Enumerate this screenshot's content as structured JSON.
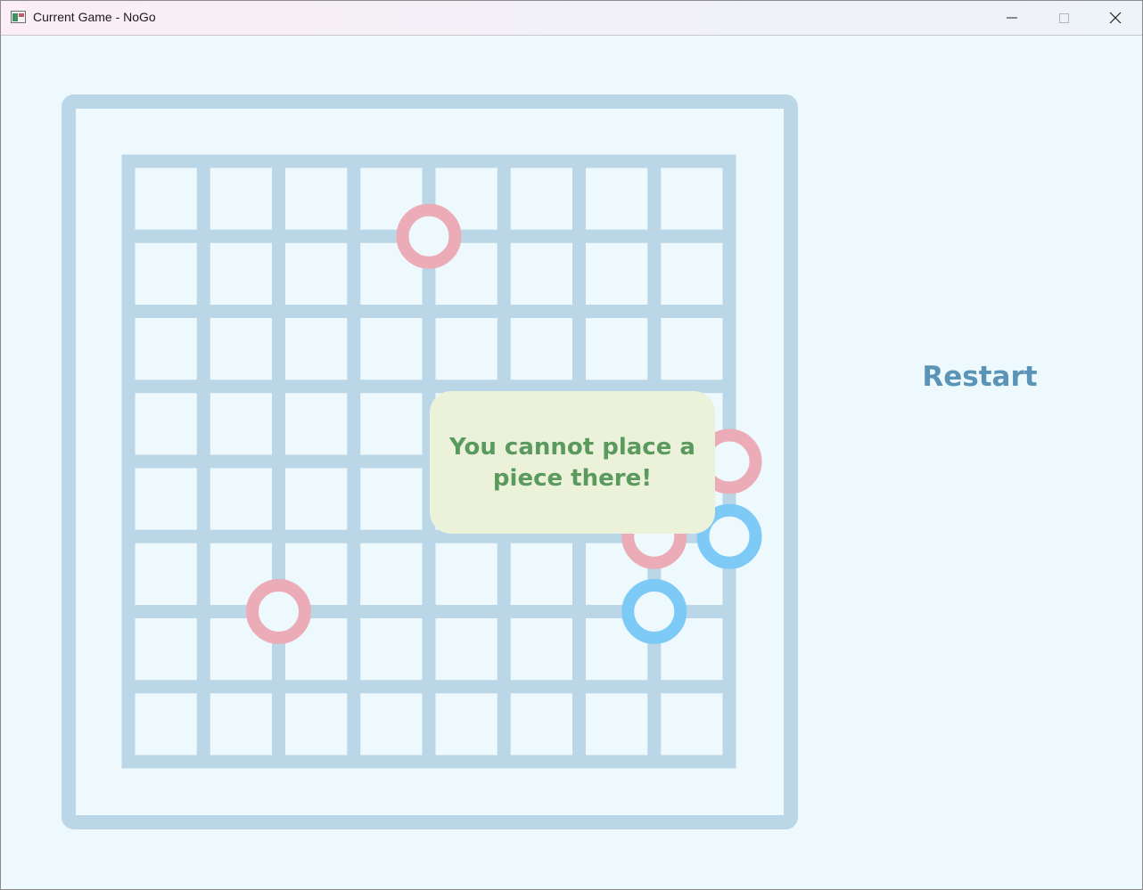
{
  "window": {
    "title": "Current Game - NoGo",
    "icons": {
      "app": "app-icon",
      "minimize": "minimize-icon",
      "maximize": "maximize-icon",
      "close": "close-icon"
    }
  },
  "board": {
    "grid_lines": 9,
    "colors": {
      "background": "#edf9fd",
      "lines": "#bbd7e7",
      "pink_stone": "#ebacb7",
      "blue_stone": "#7ecaf6"
    },
    "stones": [
      {
        "row": 1,
        "col": 4,
        "color": "pink"
      },
      {
        "row": 4,
        "col": 8,
        "color": "pink"
      },
      {
        "row": 5,
        "col": 7,
        "color": "pink"
      },
      {
        "row": 5,
        "col": 8,
        "color": "blue"
      },
      {
        "row": 6,
        "col": 2,
        "color": "pink"
      },
      {
        "row": 6,
        "col": 7,
        "color": "blue"
      }
    ]
  },
  "message": {
    "text": "You cannot place a\npiece there!"
  },
  "controls": {
    "restart_label": "Restart"
  }
}
